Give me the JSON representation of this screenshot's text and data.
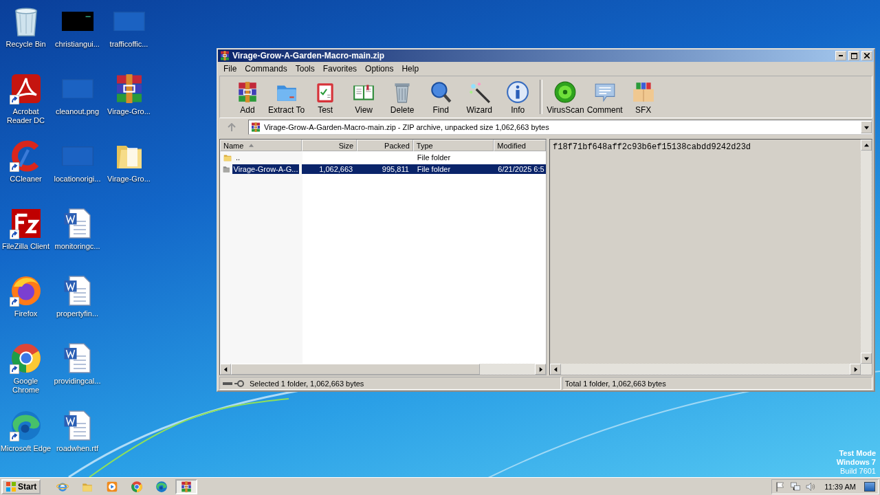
{
  "desktop": {
    "icons": [
      {
        "label": "Recycle Bin",
        "kind": "recycle",
        "shortcut": false
      },
      {
        "label": "Acrobat Reader DC",
        "kind": "acrobat",
        "shortcut": true
      },
      {
        "label": "CCleaner",
        "kind": "ccleaner",
        "shortcut": true
      },
      {
        "label": "FileZilla Client",
        "kind": "filezilla",
        "shortcut": true
      },
      {
        "label": "Firefox",
        "kind": "firefox",
        "shortcut": true
      },
      {
        "label": "Google Chrome",
        "kind": "chrome",
        "shortcut": true
      },
      {
        "label": "Microsoft Edge",
        "kind": "edge",
        "shortcut": true
      },
      {
        "label": "christiangui...",
        "kind": "dark",
        "shortcut": false
      },
      {
        "label": "cleanout.png",
        "kind": "blank",
        "shortcut": false
      },
      {
        "label": "locationorigi...",
        "kind": "blank",
        "shortcut": false
      },
      {
        "label": "monitoringc...",
        "kind": "word",
        "shortcut": false
      },
      {
        "label": "propertyfin...",
        "kind": "word",
        "shortcut": false
      },
      {
        "label": "providingcal...",
        "kind": "word",
        "shortcut": false
      },
      {
        "label": "roadwhen.rtf",
        "kind": "word",
        "shortcut": false
      },
      {
        "label": "trafficoffic...",
        "kind": "blank",
        "shortcut": false
      },
      {
        "label": "Virage-Gro...",
        "kind": "winrar",
        "shortcut": false
      },
      {
        "label": "Virage-Gro...",
        "kind": "folder",
        "shortcut": false
      }
    ],
    "test_mode": [
      "Test Mode",
      "Windows 7",
      "Build 7601"
    ]
  },
  "window": {
    "title": "Virage-Grow-A-Garden-Macro-main.zip",
    "menu": [
      "File",
      "Commands",
      "Tools",
      "Favorites",
      "Options",
      "Help"
    ],
    "toolbar": [
      {
        "label": "Add",
        "kind": "add"
      },
      {
        "label": "Extract To",
        "kind": "extract"
      },
      {
        "label": "Test",
        "kind": "test"
      },
      {
        "label": "View",
        "kind": "view"
      },
      {
        "label": "Delete",
        "kind": "delete"
      },
      {
        "label": "Find",
        "kind": "find"
      },
      {
        "label": "Wizard",
        "kind": "wizard"
      },
      {
        "label": "Info",
        "kind": "info"
      },
      {
        "label": "VirusScan",
        "kind": "virus"
      },
      {
        "label": "Comment",
        "kind": "comment"
      },
      {
        "label": "SFX",
        "kind": "sfx"
      }
    ],
    "address": "Virage-Grow-A-Garden-Macro-main.zip - ZIP archive, unpacked size 1,062,663 bytes",
    "columns": [
      {
        "label": "Name",
        "sorted": true
      },
      {
        "label": "Size",
        "sorted": false
      },
      {
        "label": "Packed",
        "sorted": false
      },
      {
        "label": "Type",
        "sorted": false
      },
      {
        "label": "Modified",
        "sorted": false
      }
    ],
    "rows": [
      {
        "kind": "parent",
        "name": "..",
        "size": "",
        "packed": "",
        "type": "File folder",
        "modified": "",
        "selected": false
      },
      {
        "kind": "folder",
        "name": "Virage-Grow-A-G...",
        "size": "1,062,663",
        "packed": "995,811",
        "type": "File folder",
        "modified": "6/21/2025 6:5",
        "selected": true
      }
    ],
    "comment": "f18f71bf648aff2c93b6ef15138cabdd9242d23d",
    "status_left": "Selected 1 folder, 1,062,663 bytes",
    "status_right": "Total 1 folder, 1,062,663 bytes"
  },
  "taskbar": {
    "start": "Start",
    "apps": [
      {
        "kind": "ie",
        "active": false
      },
      {
        "kind": "explorer",
        "active": false
      },
      {
        "kind": "media",
        "active": false
      },
      {
        "kind": "chrome",
        "active": false
      },
      {
        "kind": "edge",
        "active": false
      },
      {
        "kind": "add",
        "active": true
      }
    ],
    "clock": "11:39 AM"
  }
}
